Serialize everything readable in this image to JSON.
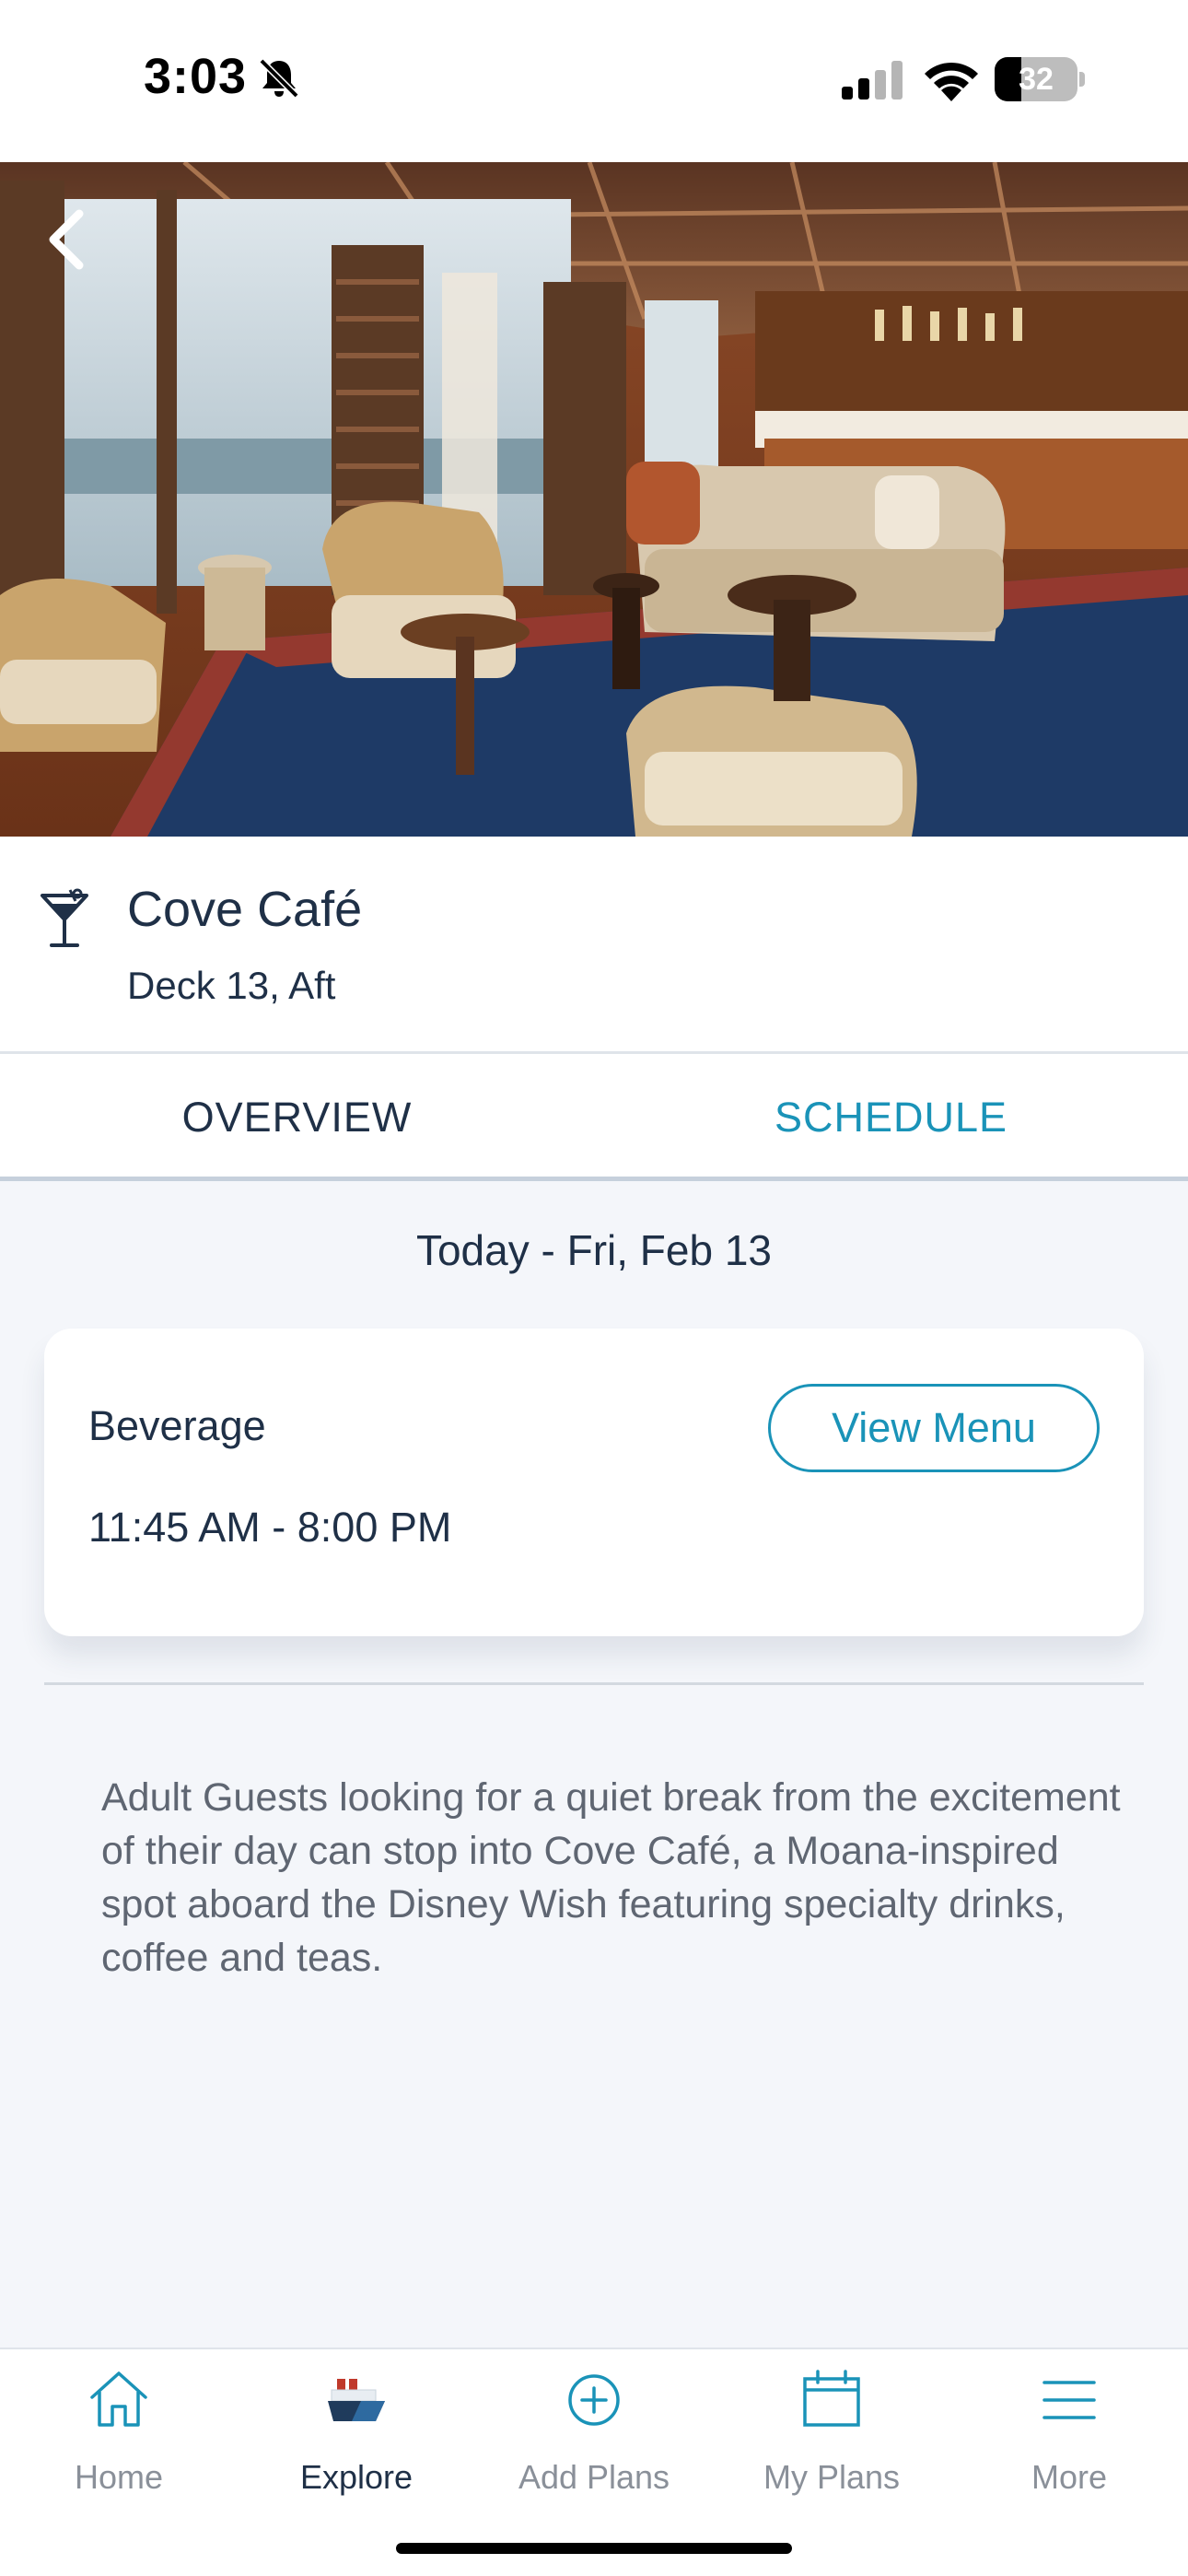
{
  "status_bar": {
    "time": "3:03",
    "battery_level": "32",
    "battery_percent": 32,
    "icons": [
      "bell-slash-icon",
      "cellular-signal-icon",
      "wifi-icon",
      "battery-icon"
    ]
  },
  "hero": {
    "icons": [
      "chevron-left-icon"
    ]
  },
  "venue": {
    "icon": "cocktail-icon",
    "name": "Cove Café",
    "location": "Deck 13, Aft"
  },
  "tabs": [
    {
      "label": "OVERVIEW"
    },
    {
      "label": "SCHEDULE"
    }
  ],
  "schedule": {
    "date": "Today - Fri, Feb 13",
    "card": {
      "category": "Beverage",
      "hours": "11:45 AM - 8:00 PM",
      "view_menu_label": "View Menu"
    }
  },
  "description": "Adult Guests looking for a quiet break from the excitement of their day can stop into Cove Café, a Moana-inspired spot aboard the Disney Wish featuring specialty drinks, coffee and teas.",
  "bottom_nav": [
    {
      "label": "Home",
      "icon": "home-icon"
    },
    {
      "label": "Explore",
      "icon": "ship-icon"
    },
    {
      "label": "Add Plans",
      "icon": "plus-circle-icon"
    },
    {
      "label": "My Plans",
      "icon": "calendar-icon"
    },
    {
      "label": "More",
      "icon": "menu-icon"
    }
  ],
  "colors": {
    "accent": "#1a93b8",
    "text_primary": "#1f3047",
    "text_secondary": "#5f6672",
    "background": "#f4f6fa"
  }
}
